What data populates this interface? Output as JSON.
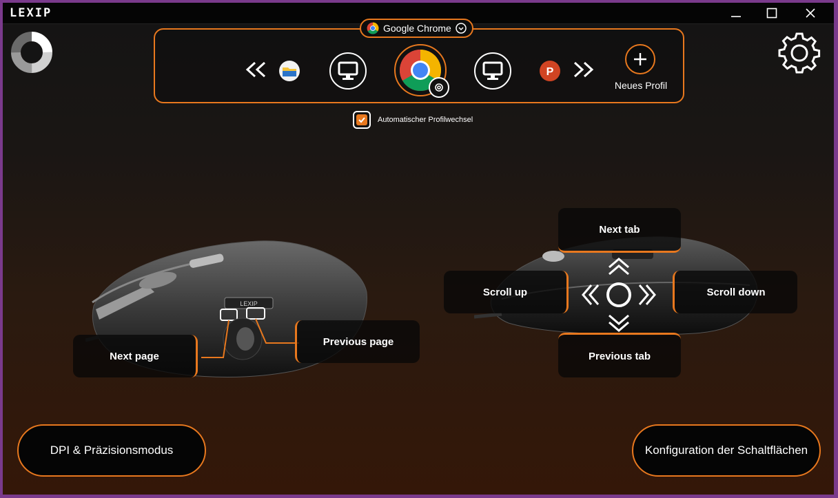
{
  "titlebar": {
    "logo": "LEXIP"
  },
  "profile": {
    "selected_app": "Google Chrome",
    "new_profile_label": "Neues Profil",
    "auto_switch_label": "Automatischer Profilwechsel",
    "auto_switch_checked": true
  },
  "mouse_left": {
    "next_page": "Next page",
    "previous_page": "Previous page",
    "brand": "LEXIP"
  },
  "mouse_right": {
    "next_tab": "Next tab",
    "scroll_up": "Scroll up",
    "scroll_down": "Scroll down",
    "previous_tab": "Previous tab"
  },
  "buttons": {
    "dpi": "DPI & Präzisionsmodus",
    "config": "Konfiguration der Schaltflächen"
  },
  "colors": {
    "accent": "#e8781e",
    "background": "#141414"
  }
}
